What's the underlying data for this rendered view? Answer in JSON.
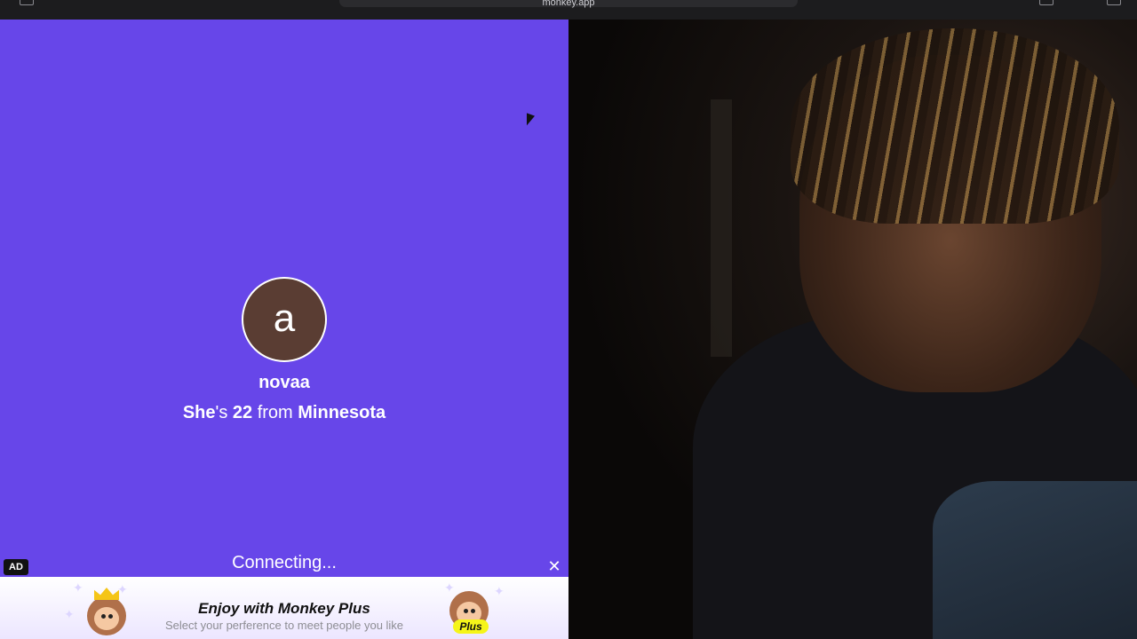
{
  "browser": {
    "url": "monkey.app"
  },
  "profile": {
    "avatar_letter": "a",
    "username": "novaa",
    "pronoun": "She",
    "pronoun_suffix": "'s",
    "age": "22",
    "from_word": "from",
    "location": "Minnesota"
  },
  "status": {
    "connecting": "Connecting..."
  },
  "ad": {
    "badge": "AD",
    "close_symbol": "✕",
    "title": "Enjoy with Monkey Plus",
    "subtitle": "Select your perference to meet people you like",
    "plus_label": "Plus"
  }
}
